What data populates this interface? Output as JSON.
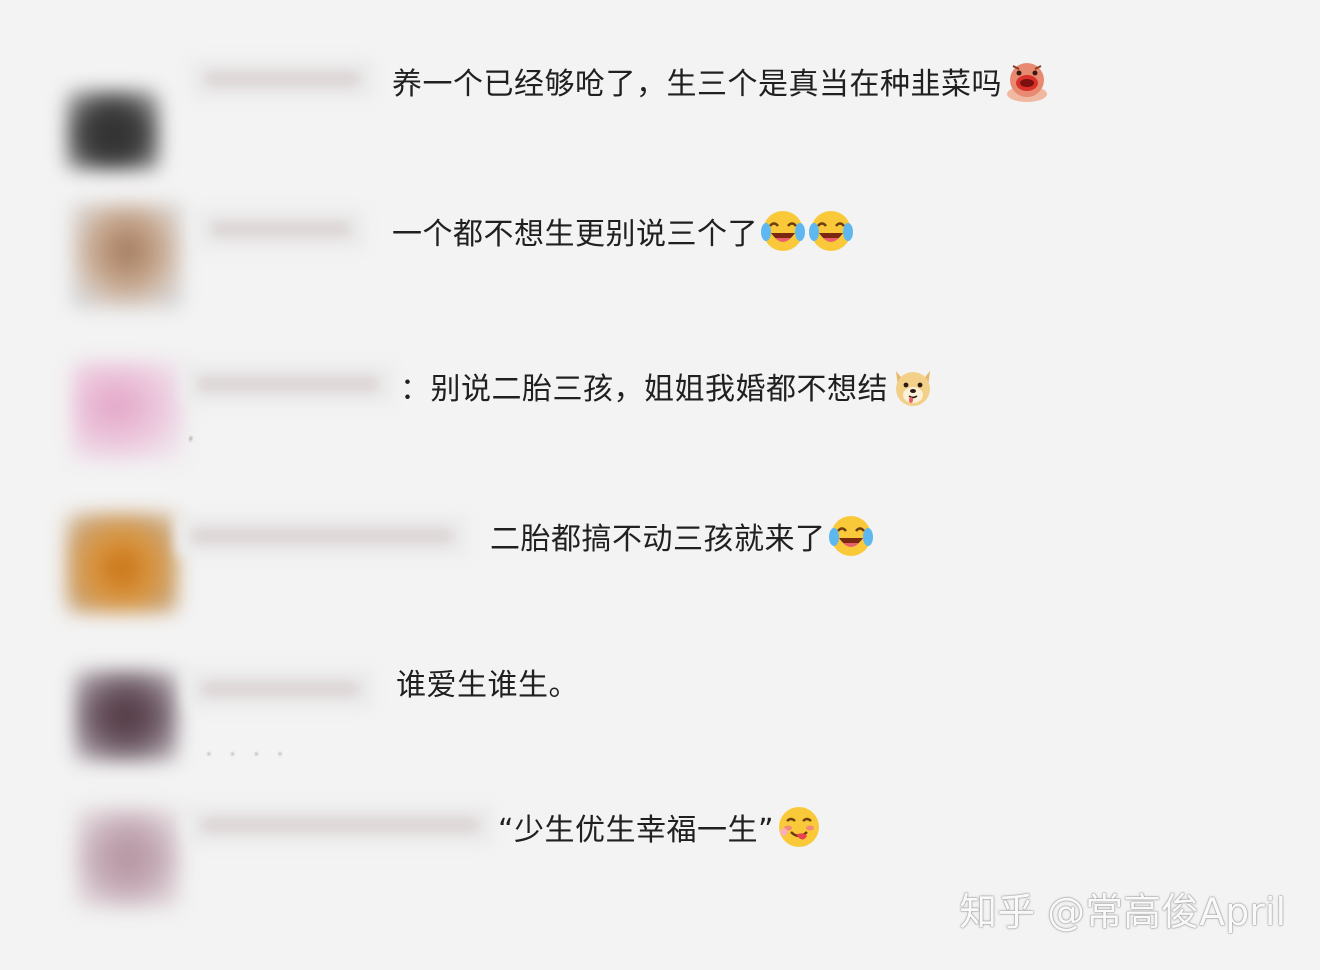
{
  "comments": [
    {
      "text": "养一个已经够呛了，生三个是真当在种韭菜吗",
      "emojis": [
        "pig-face-emoji"
      ],
      "avatar_color": "#3a3a3a"
    },
    {
      "text": "一个都不想生更别说三个了",
      "emojis": [
        "laughing-crying-emoji",
        "laughing-crying-emoji"
      ],
      "avatar_color": "#b89a85"
    },
    {
      "text": "：别说二胎三孩，姐姐我婚都不想结",
      "emojis": [
        "doge-emoji"
      ],
      "avatar_color": "#e6b8d8"
    },
    {
      "text": "二胎都搞不动三孩就来了",
      "emojis": [
        "laughing-crying-emoji"
      ],
      "avatar_color": "#d68a2e"
    },
    {
      "text": "谁爱生谁生。",
      "emojis": [],
      "avatar_color": "#5a4a55"
    },
    {
      "text": "“少生优生幸福一生”",
      "emojis": [
        "yum-face-emoji"
      ],
      "avatar_color": "#c2a8b2"
    }
  ],
  "watermark": "知乎 @常高俊April"
}
